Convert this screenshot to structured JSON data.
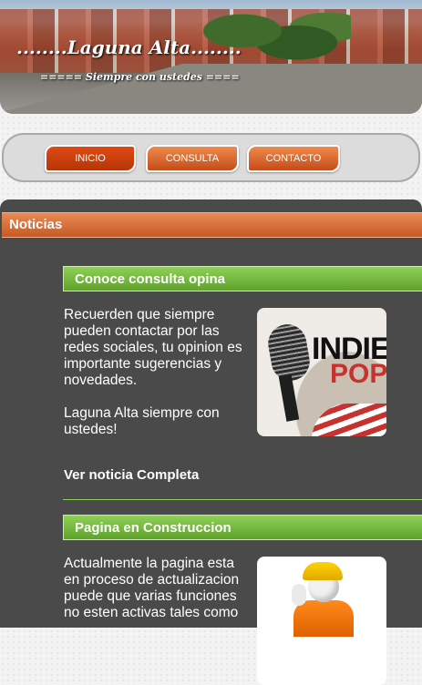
{
  "header": {
    "title": "........Laguna Alta........",
    "subtitle": "===== Siempre con ustedes ===="
  },
  "nav": {
    "items": [
      {
        "label": "INICIO",
        "active": true
      },
      {
        "label": "CONSULTA",
        "active": false
      },
      {
        "label": "CONTACTO",
        "active": false
      }
    ]
  },
  "news": {
    "section_title": "Noticias",
    "articles": [
      {
        "title": "Conoce consulta opina",
        "paragraphs": [
          "Recuerden que siempre pueden contactar por las redes sociales, tu opinion es importante sugerencias y novedades.",
          "Laguna Alta siempre con ustedes!"
        ],
        "read_more": "Ver noticia Completa",
        "image_text": [
          "INDIE",
          "POP"
        ]
      },
      {
        "title": "Pagina en Construccion",
        "paragraphs": [
          "Actualmente la pagina esta en proceso de actualizacion puede que varias funciones no esten activas tales como"
        ]
      }
    ]
  },
  "colors": {
    "accent_orange": "#d4622b",
    "accent_green": "#79bd41",
    "panel_bg": "#4a4a4a"
  }
}
